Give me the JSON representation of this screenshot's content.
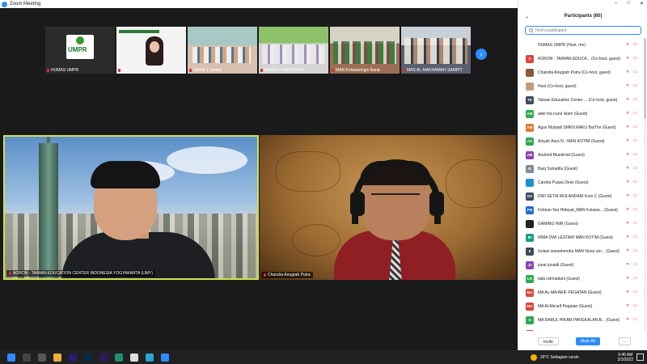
{
  "window": {
    "title": "Zoom Meeting"
  },
  "window_controls": [
    "–",
    "□",
    "✕"
  ],
  "strip": {
    "thumbnails": [
      {
        "name": "HUMAS UMPR",
        "logo_text": "UMPR"
      },
      {
        "name": "Ica..."
      },
      {
        "name": "SMKN 1 Sampit"
      },
      {
        "name": "SMAN-1 P.BANTENS..."
      },
      {
        "name": "MAN Kotawaringin Barat"
      },
      {
        "name": "MAS AL-MAKHAMAH SAMPIT"
      }
    ],
    "next_label": "›"
  },
  "videos": [
    {
      "name": "AORON - TAIWAN EDUCATION CENTER INDONESIA YOGYAKARTA (UMY)"
    },
    {
      "name": "Chandra Anugrah Putra"
    }
  ],
  "panel": {
    "title": "Participants (80)",
    "collapse_label": "⌄",
    "search_placeholder": "Find a participant",
    "participants": [
      {
        "initials": "",
        "name": "HUMAS UMPR (Host, me)",
        "color": "#ffffff"
      },
      {
        "initials": "A",
        "name": "AORON - TAIWAN EDUCA... (Co-host, guest)",
        "color": "#e0453a"
      },
      {
        "initials": "",
        "name": "Chandra Anugrah Putra (Co-host, guest)",
        "color": "#8b5a3a"
      },
      {
        "initials": "",
        "name": "Host (Co-host, guest)",
        "color": "#c79a7a"
      },
      {
        "initials": "TE",
        "name": "Taiwan Education Center ... (Co-host, guest)",
        "color": "#3d4a5c"
      },
      {
        "initials": "AM",
        "name": "adel ma nurul islam (Guest)",
        "color": "#2fa84f"
      },
      {
        "initials": "AM",
        "name": "Agus Mulyadi SMKN RAKU BarTim (Guest)",
        "color": "#e07a2b"
      },
      {
        "initials": "AA",
        "name": "Aisyah Aura N - MAN KOTIM (Guest)",
        "color": "#2fa84f"
      },
      {
        "initials": "AB",
        "name": "Android Bluedroid (Guest)",
        "color": "#8e44ad"
      },
      {
        "initials": "B",
        "name": "Baiq Sortadila (Guest)",
        "color": "#7f8c9a"
      },
      {
        "initials": "",
        "name": "Candra Puspa Dewi (Guest)",
        "color": "#1f8fc9"
      },
      {
        "initials": "DS",
        "name": "DWI SETIA WULANDARI Kom C (Guest)",
        "color": "#3d4a5c"
      },
      {
        "initials": "FN",
        "name": "Febrian Nur Hidayat_MAN Kotawa... (Guest)",
        "color": "#1f6fc9"
      },
      {
        "initials": "",
        "name": "GAMING HdR (Guest)",
        "color": "#222222"
      },
      {
        "initials": "ID",
        "name": "IRMA DWI LESTARI MAN KOTIM (Guest)",
        "color": "#16a085"
      },
      {
        "initials": "II",
        "name": "Isolasi izamahendra MAN Nurul um... (Guest)",
        "color": "#3d4a5c"
      },
      {
        "initials": "JJ",
        "name": "junai junaidi (Guest)",
        "color": "#8e44ad"
      },
      {
        "initials": "LR",
        "name": "laila rahmadani (Guest)",
        "color": "#2fa84f"
      },
      {
        "initials": "MA",
        "name": "MA AL-MA'ARIF PEGATAN (Guest)",
        "color": "#e0453a"
      },
      {
        "initials": "MA",
        "name": "MA Al-Ma'arif Pegatan (Guest)",
        "color": "#e0453a"
      },
      {
        "initials": "S",
        "name": "MA DARUL HIKAM PANGKALAN B... (Guest)",
        "color": "#2fa84f"
      },
      {
        "initials": "",
        "name": "",
        "color": "#e0453a"
      }
    ],
    "invite_label": "Invite",
    "mute_all_label": "Mute All",
    "more_label": "···"
  },
  "taskbar": {
    "weather": "26°C  Sebagian cerah",
    "time": "9:46 AM",
    "date": "3/3/2022"
  }
}
